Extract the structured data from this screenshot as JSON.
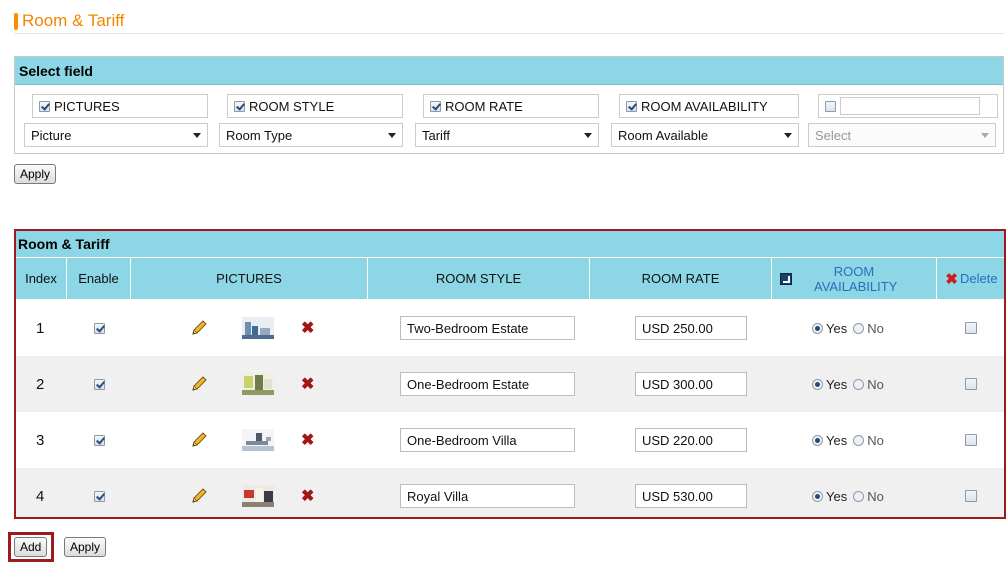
{
  "page": {
    "title": "Room & Tariff"
  },
  "select_field": {
    "heading": "Select field",
    "fields": [
      {
        "label": "PICTURES",
        "checked": true
      },
      {
        "label": "ROOM STYLE",
        "checked": true
      },
      {
        "label": "ROOM RATE",
        "checked": true
      },
      {
        "label": "ROOM AVAILABILITY",
        "checked": true
      },
      {
        "label": "",
        "checked": false
      }
    ],
    "selects": [
      {
        "value": "Picture"
      },
      {
        "value": "Room Type"
      },
      {
        "value": "Tariff"
      },
      {
        "value": "Room Available"
      },
      {
        "value": "Select",
        "disabled": true
      }
    ],
    "apply_label": "Apply"
  },
  "table": {
    "heading": "Room & Tariff",
    "columns": {
      "index": "Index",
      "enable": "Enable",
      "pictures": "PICTURES",
      "room_style": "ROOM STYLE",
      "room_rate": "ROOM RATE",
      "room_availability": "ROOM AVAILABILITY",
      "delete": "Delete"
    },
    "radio_yes": "Yes",
    "radio_no": "No",
    "rows": [
      {
        "index": "1",
        "enabled": true,
        "room_style": "Two-Bedroom Estate",
        "room_rate": "USD 250.00",
        "available": "Yes",
        "delete": false
      },
      {
        "index": "2",
        "enabled": true,
        "room_style": "One-Bedroom Estate",
        "room_rate": "USD 300.00",
        "available": "Yes",
        "delete": false
      },
      {
        "index": "3",
        "enabled": true,
        "room_style": "One-Bedroom Villa",
        "room_rate": "USD 220.00",
        "available": "Yes",
        "delete": false
      },
      {
        "index": "4",
        "enabled": true,
        "room_style": "Royal Villa",
        "room_rate": "USD 530.00",
        "available": "Yes",
        "delete": false
      }
    ]
  },
  "footer": {
    "add_label": "Add",
    "apply_label": "Apply"
  },
  "colors": {
    "accent": "#f28400",
    "header_bg": "#8cd6e5",
    "highlight_border": "#9b1b1f",
    "link_blue": "#2a6ebd"
  },
  "icons": [
    "pencil-icon",
    "remove-picture-icon",
    "delete-x-icon",
    "sort-icon",
    "checkbox",
    "radio"
  ]
}
